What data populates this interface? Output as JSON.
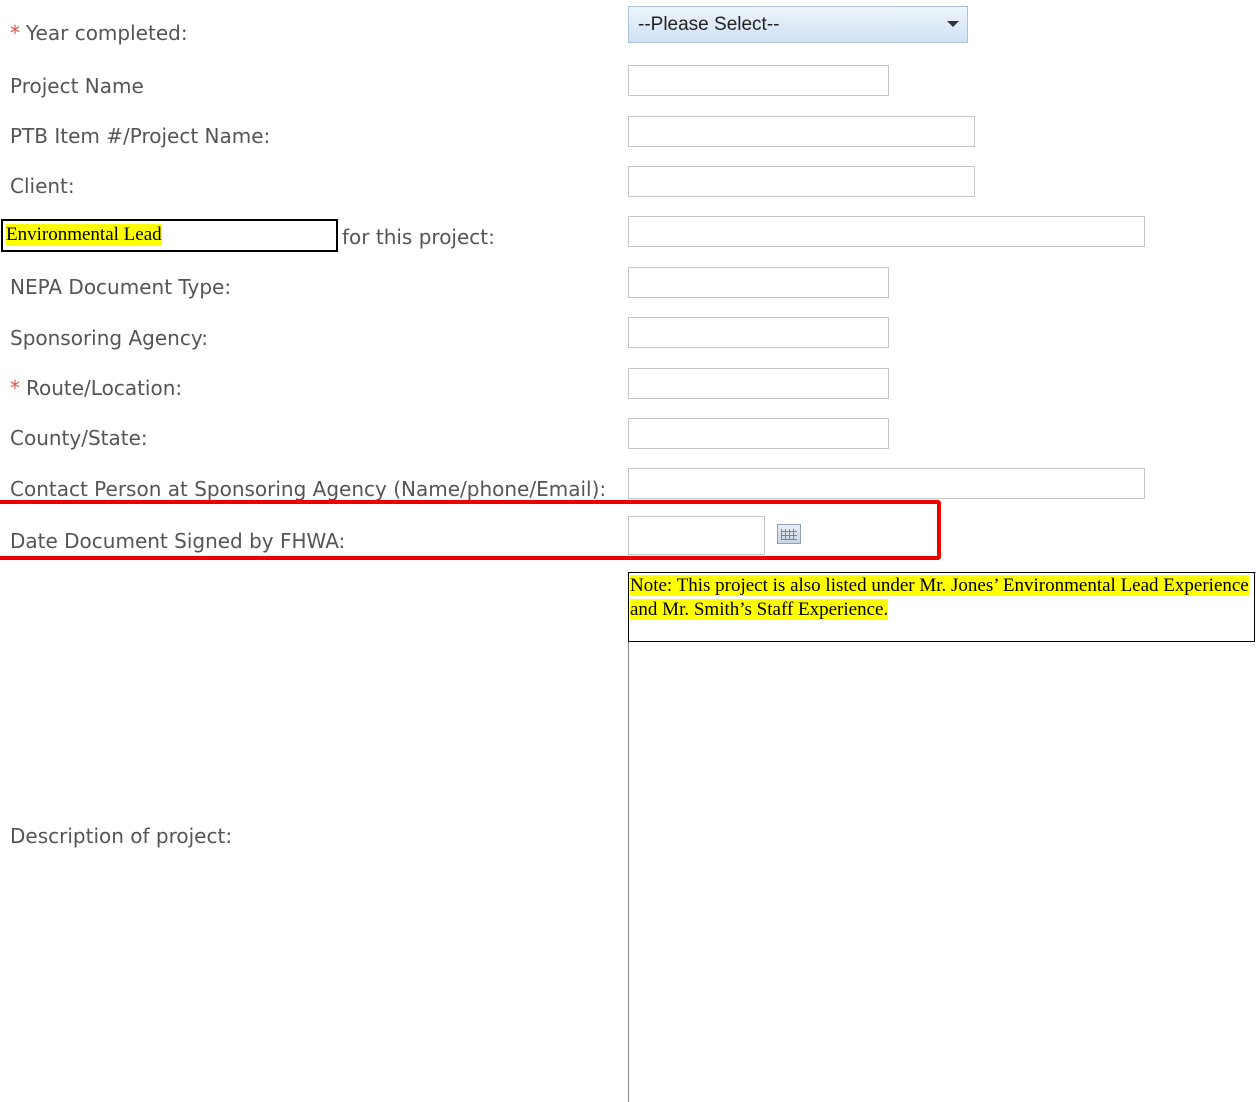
{
  "form": {
    "required_marker": "*",
    "year_completed": {
      "label": "Year completed:",
      "value": "--Please Select--"
    },
    "project_name": {
      "label": "Project Name",
      "value": ""
    },
    "ptb_item": {
      "label": "PTB Item #/Project Name:",
      "value": ""
    },
    "client": {
      "label": "Client:",
      "value": ""
    },
    "role": {
      "highlight": "Environmental Lead",
      "label": "for this project:",
      "value": ""
    },
    "nepa_document_type": {
      "label": "NEPA Document Type:",
      "value": ""
    },
    "sponsoring_agency": {
      "label": "Sponsoring Agency:",
      "value": ""
    },
    "route_location": {
      "label": "Route/Location:",
      "value": ""
    },
    "county_state": {
      "label": "County/State:",
      "value": ""
    },
    "contact_person": {
      "label": "Contact Person at Sponsoring Agency (Name/phone/Email):",
      "value": ""
    },
    "date_signed": {
      "label": "Date Document Signed by FHWA:",
      "value": ""
    },
    "description": {
      "label": "Description of project:",
      "note": "Note:  This project is also listed under Mr. Jones’ Environmental Lead Experience and Mr. Smith’s Staff Experience."
    }
  },
  "icons": {
    "calendar": "calendar-icon",
    "dropdown": "chevron-down-icon"
  },
  "colors": {
    "required": "#d9534f",
    "highlight": "#ffff00",
    "annotation_border": "#ee0000"
  }
}
